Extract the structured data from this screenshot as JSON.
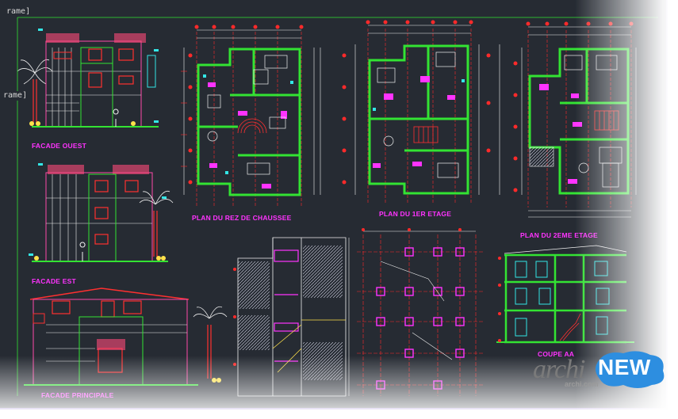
{
  "window": {
    "tab_label": "rame]"
  },
  "drawings": {
    "facade_ouest": "FACADE OUEST",
    "facade_est": "FACADE EST",
    "facade_principale": "FACADE PRINCIPALE",
    "plan_rdc": "PLAN DU REZ DE CHAUSSEE",
    "plan_1er": "PLAN DU 1ER ETAGE",
    "plan_2eme": "PLAN DU 2EME ETAGE",
    "coupe": "COUPE AA"
  },
  "watermark": {
    "brand": "archi",
    "domain": "archi.com",
    "badge": "NEW"
  },
  "colors": {
    "background": "#262b33",
    "wall_green": "#33e333",
    "axis_red": "#ff2a2a",
    "magenta": "#ff33ff",
    "cyan": "#33e6e6",
    "yellow": "#ffe24a",
    "badge_blue": "#2d8ee0"
  }
}
